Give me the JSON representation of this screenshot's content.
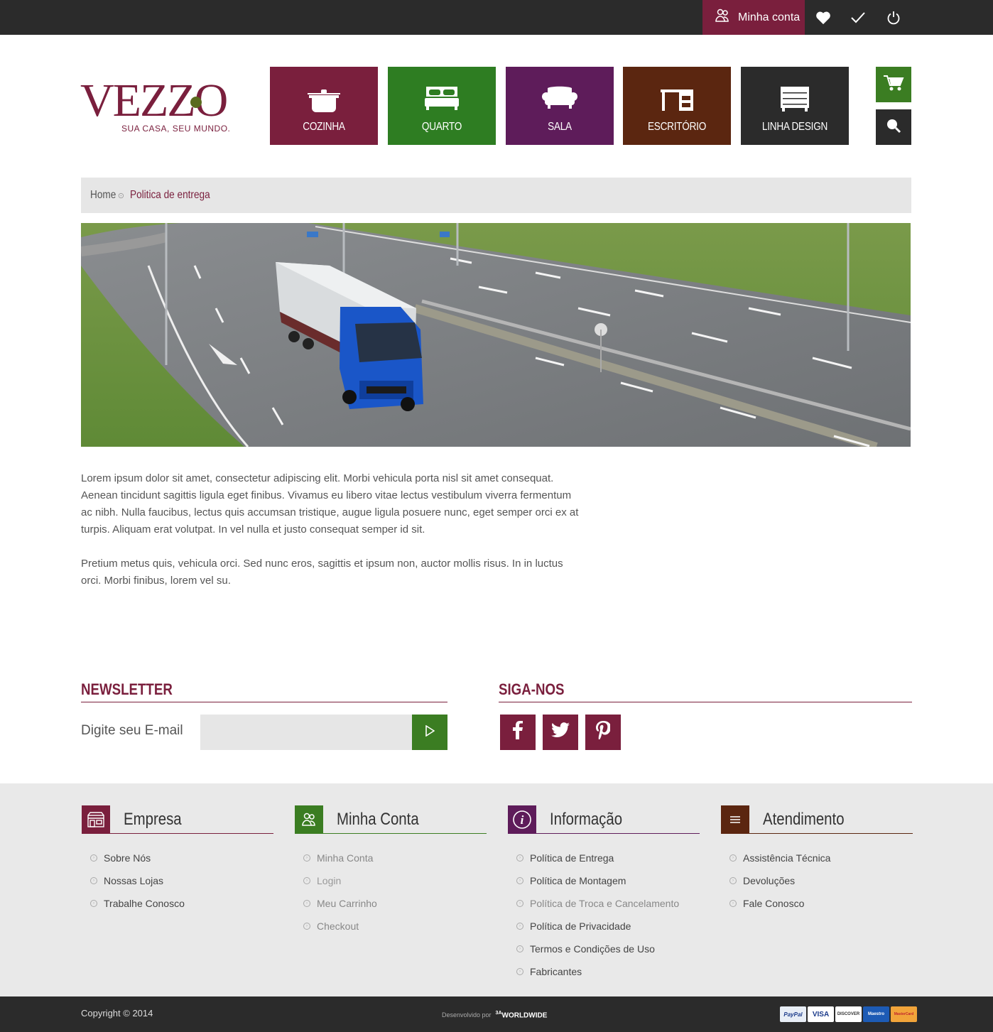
{
  "topbar": {
    "account_label": "Minha conta",
    "icons": [
      "heart-icon",
      "check-icon",
      "power-icon"
    ]
  },
  "logo": {
    "brand": "VEZZO",
    "tagline": "SUA CASA, SEU MUNDO."
  },
  "categories": [
    {
      "label": "COZINHA",
      "color": "#7a1f3d",
      "icon": "pot-icon"
    },
    {
      "label": "QUARTO",
      "color": "#2e7d22",
      "icon": "bed-icon"
    },
    {
      "label": "SALA",
      "color": "#5e1c5a",
      "icon": "sofa-icon"
    },
    {
      "label": "ESCRITÓRIO",
      "color": "#5b2610",
      "icon": "desk-icon"
    },
    {
      "label": "LINHA DESIGN",
      "color": "#2b2b2b",
      "icon": "drawers-icon"
    }
  ],
  "side_buttons": {
    "cart_color": "#3b7d22",
    "search_color": "#2b2b2b"
  },
  "breadcrumb": {
    "home": "Home",
    "current": "Politica de entrega"
  },
  "content": {
    "p1": "Lorem ipsum dolor sit amet, consectetur adipiscing elit. Morbi vehicula porta nisl sit amet consequat. Aenean tincidunt sagittis ligula eget finibus. Vivamus eu libero vitae lectus vestibulum viverra fermentum ac nibh. Nulla faucibus, lectus quis accumsan tristique, augue ligula posuere nunc, eget semper orci ex at turpis. Aliquam erat volutpat. In vel nulla et justo consequat semper id sit.",
    "p2": "Pretium metus quis, vehicula orci. Sed nunc eros, sagittis et ipsum non, auctor mollis risus. In in luctus orci. Morbi finibus, lorem vel su."
  },
  "newsletter": {
    "title": "NEWSLETTER",
    "label": "Digite seu E-mail",
    "placeholder": ""
  },
  "follow": {
    "title": "SIGA-NOS",
    "networks": [
      "facebook",
      "twitter",
      "pinterest"
    ]
  },
  "footer": {
    "columns": [
      {
        "title": "Empresa",
        "color": "#7a1f3d",
        "icon": "store-icon",
        "items": [
          "Sobre Nós",
          "Nossas Lojas",
          "Trabalhe Conosco"
        ]
      },
      {
        "title": "Minha Conta",
        "color": "#3b7d22",
        "icon": "users-icon",
        "items": [
          "Minha Conta",
          "Login",
          "Meu Carrinho",
          "Checkout"
        ]
      },
      {
        "title": "Informação",
        "color": "#5e1c5a",
        "icon": "info-icon",
        "items": [
          "Política de Entrega",
          "Política de Montagem",
          "Política de Troca e Cancelamento",
          "Política de Privacidade",
          "Termos e Condições de Uso",
          "Fabricantes"
        ]
      },
      {
        "title": "Atendimento",
        "color": "#5b2610",
        "icon": "menu-icon",
        "items": [
          "Assistência Técnica",
          "Devoluções",
          "Fale Conosco"
        ]
      }
    ]
  },
  "bottom": {
    "copyright": "Copyright © 2014",
    "developed_by": "Desenvolvido por",
    "developer": "WORLDWIDE",
    "developer_prefix": "3A",
    "payments": [
      "PayPal",
      "VISA",
      "DISCOVER",
      "Maestro",
      "MasterCard"
    ]
  }
}
